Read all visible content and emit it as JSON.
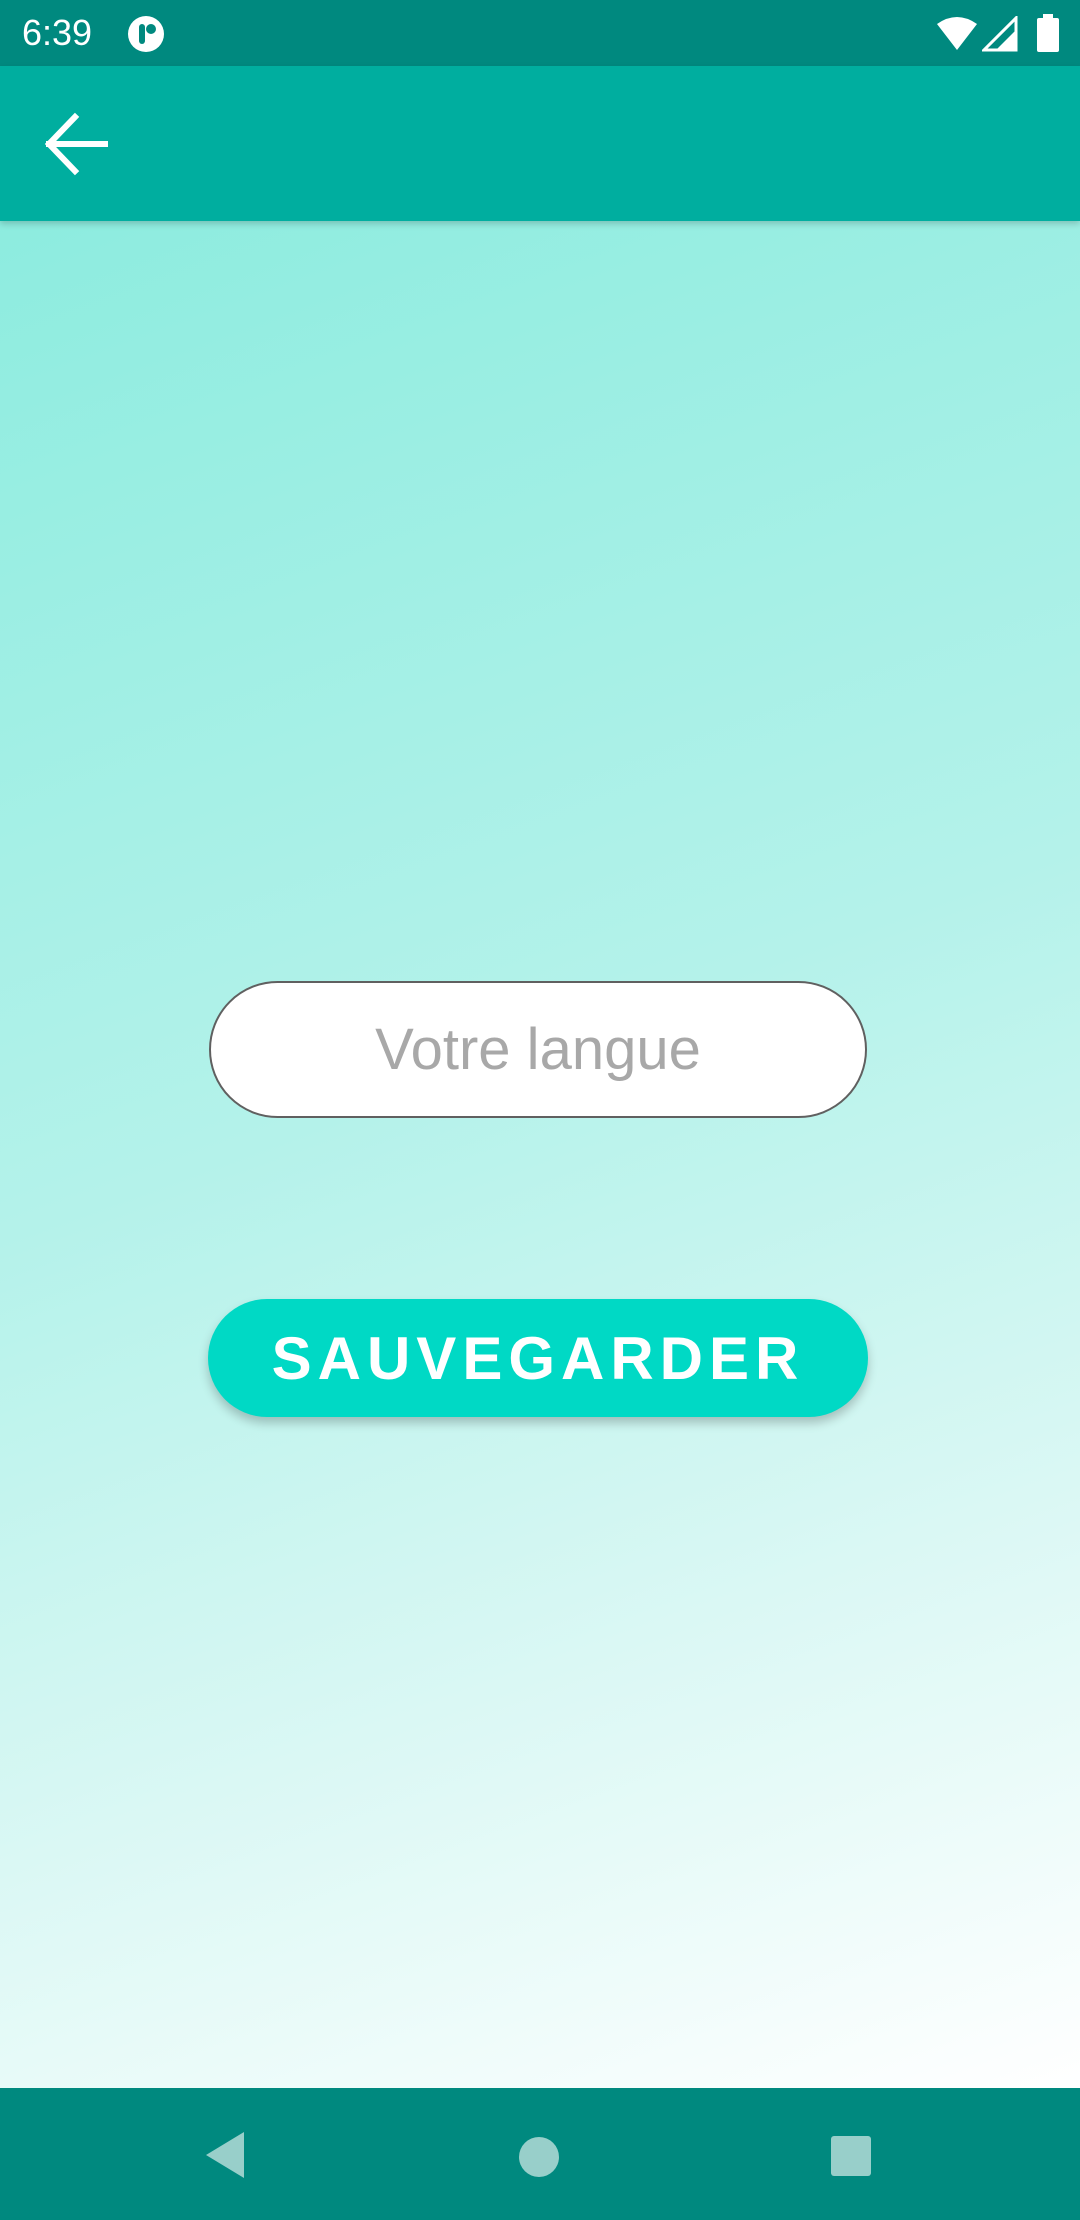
{
  "status_bar": {
    "time": "6:39",
    "icons": [
      "app-notification-icon",
      "wifi-icon",
      "signal-icon",
      "battery-icon"
    ]
  },
  "app_bar": {
    "back_icon": "arrow-left-icon"
  },
  "form": {
    "language_placeholder": "Votre langue",
    "language_value": "",
    "save_label": "SAUVEGARDER"
  },
  "nav_bar": {
    "icons": [
      "nav-back-icon",
      "nav-home-icon",
      "nav-recents-icon"
    ]
  },
  "colors": {
    "status_bar": "#00897f",
    "app_bar": "#00ae9f",
    "button": "#00d9c5",
    "gradient_top": "#8decdf",
    "gradient_bottom": "#ffffff"
  }
}
